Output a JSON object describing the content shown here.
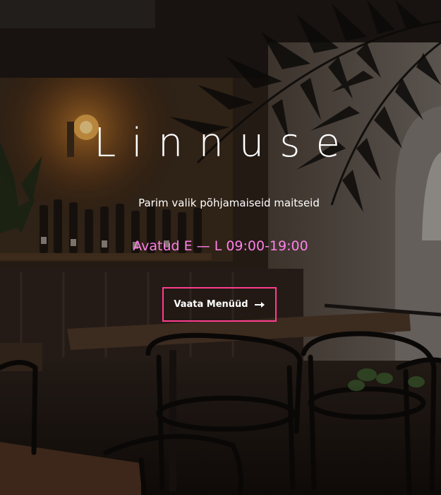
{
  "hero": {
    "title": "Linnuse",
    "subtitle": "Parim valik põhjamaiseid maitseid",
    "hours": "Avatud E — L 09:00-19:00",
    "cta_label": "Vaata Menüüd",
    "cta_icon": "arrow-right-icon"
  },
  "colors": {
    "hours_text": "#ff80e8",
    "cta_border": "#ff3d8e"
  }
}
